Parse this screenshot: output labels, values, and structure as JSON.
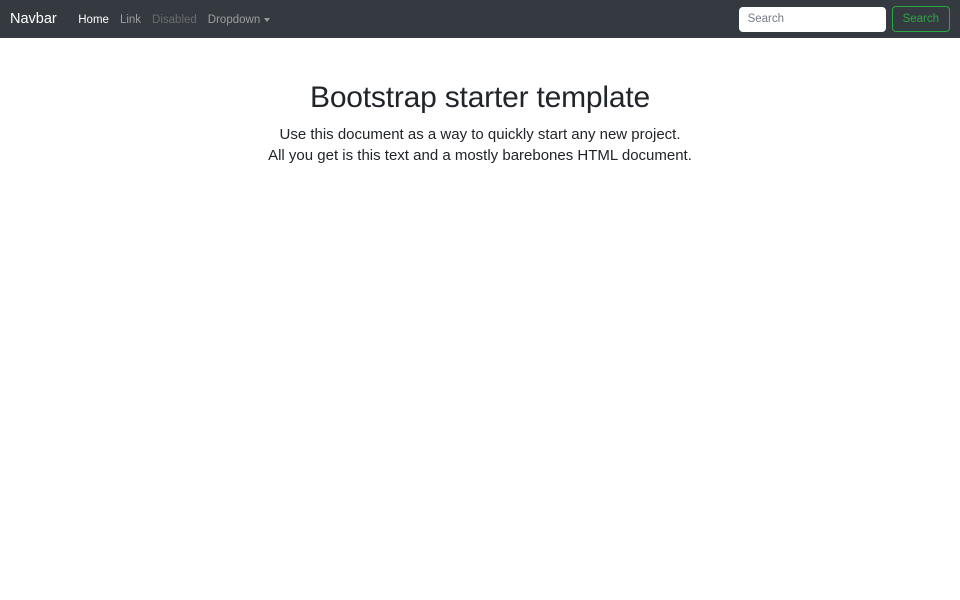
{
  "navbar": {
    "brand": "Navbar",
    "items": [
      {
        "label": "Home",
        "state": "active"
      },
      {
        "label": "Link",
        "state": "muted"
      },
      {
        "label": "Disabled",
        "state": "disabled"
      },
      {
        "label": "Dropdown",
        "state": "muted",
        "has_caret": true
      }
    ],
    "search": {
      "placeholder": "Search",
      "button_label": "Search"
    },
    "colors": {
      "background": "#343a40",
      "success_outline": "#28a745"
    }
  },
  "main": {
    "title": "Bootstrap starter template",
    "lead_line1": "Use this document as a way to quickly start any new project.",
    "lead_line2": "All you get is this text and a mostly barebones HTML document."
  }
}
